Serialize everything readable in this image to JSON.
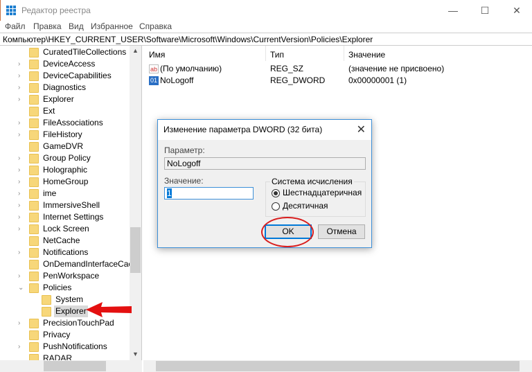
{
  "window": {
    "title": "Редактор реестра",
    "controls": [
      "—",
      "☐",
      "✕"
    ]
  },
  "menu": [
    "Файл",
    "Правка",
    "Вид",
    "Избранное",
    "Справка"
  ],
  "address": "Компьютер\\HKEY_CURRENT_USER\\Software\\Microsoft\\Windows\\CurrentVersion\\Policies\\Explorer",
  "tree": [
    {
      "label": "CuratedTileCollections",
      "expander": "none"
    },
    {
      "label": "DeviceAccess",
      "expander": "collapsed"
    },
    {
      "label": "DeviceCapabilities",
      "expander": "collapsed"
    },
    {
      "label": "Diagnostics",
      "expander": "collapsed"
    },
    {
      "label": "Explorer",
      "expander": "collapsed"
    },
    {
      "label": "Ext",
      "expander": "none"
    },
    {
      "label": "FileAssociations",
      "expander": "collapsed"
    },
    {
      "label": "FileHistory",
      "expander": "collapsed"
    },
    {
      "label": "GameDVR",
      "expander": "none"
    },
    {
      "label": "Group Policy",
      "expander": "collapsed"
    },
    {
      "label": "Holographic",
      "expander": "collapsed"
    },
    {
      "label": "HomeGroup",
      "expander": "collapsed"
    },
    {
      "label": "ime",
      "expander": "collapsed"
    },
    {
      "label": "ImmersiveShell",
      "expander": "collapsed"
    },
    {
      "label": "Internet Settings",
      "expander": "collapsed"
    },
    {
      "label": "Lock Screen",
      "expander": "collapsed"
    },
    {
      "label": "NetCache",
      "expander": "none"
    },
    {
      "label": "Notifications",
      "expander": "collapsed"
    },
    {
      "label": "OnDemandInterfaceCach",
      "expander": "none"
    },
    {
      "label": "PenWorkspace",
      "expander": "collapsed"
    },
    {
      "label": "Policies",
      "expander": "expanded"
    },
    {
      "label": "System",
      "expander": "none",
      "child": true
    },
    {
      "label": "Explorer",
      "expander": "none",
      "child": true,
      "selected": true
    },
    {
      "label": "PrecisionTouchPad",
      "expander": "collapsed"
    },
    {
      "label": "Privacy",
      "expander": "none"
    },
    {
      "label": "PushNotifications",
      "expander": "collapsed"
    },
    {
      "label": "RADAR",
      "expander": "none"
    }
  ],
  "list": {
    "columns": [
      "Имя",
      "Тип",
      "Значение"
    ],
    "rows": [
      {
        "icon": "string-value-icon",
        "name": "(По умолчанию)",
        "type": "REG_SZ",
        "value": "(значение не присвоено)"
      },
      {
        "icon": "binary-value-icon",
        "name": "NoLogoff",
        "type": "REG_DWORD",
        "value": "0x00000001 (1)"
      }
    ]
  },
  "dialog": {
    "title": "Изменение параметра DWORD (32 бита)",
    "param_label": "Параметр:",
    "param_value": "NoLogoff",
    "value_label": "Значение:",
    "value": "1",
    "base_label": "Система исчисления",
    "hex_label": "Шестнадцатеричная",
    "dec_label": "Десятичная",
    "selected_base": "hex",
    "ok": "OK",
    "cancel": "Отмена"
  },
  "annotation_color": "#d81e1e"
}
